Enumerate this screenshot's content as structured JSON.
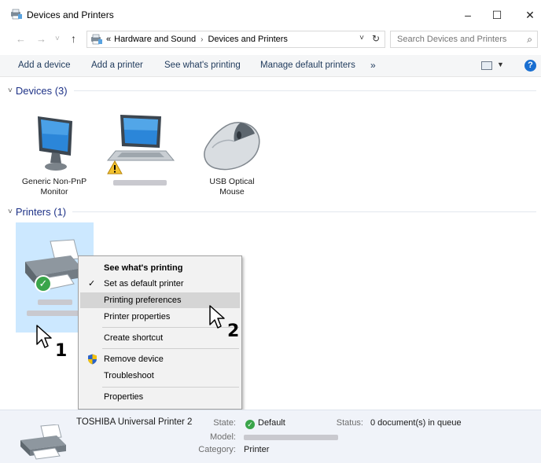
{
  "window": {
    "title": "Devices and Printers",
    "minimize": "–",
    "maximize": "☐",
    "close": "✕"
  },
  "nav": {
    "back": "←",
    "forward": "→",
    "recent": "˅",
    "up": "↑"
  },
  "address": {
    "overflow": "«",
    "crumbs": [
      "Hardware and Sound",
      "Devices and Printers"
    ],
    "separator": "›",
    "dropdown": "˅",
    "refresh": "↻"
  },
  "search": {
    "placeholder": "Search Devices and Printers",
    "icon": "⌕"
  },
  "toolbar": {
    "add_device": "Add a device",
    "add_printer": "Add a printer",
    "see_printing": "See what's printing",
    "manage_default": "Manage default printers",
    "more": "»",
    "view_dropdown": "▼",
    "help": "?"
  },
  "groups": {
    "devices": {
      "chevron": "˅",
      "label": "Devices (3)"
    },
    "printers": {
      "chevron": "˅",
      "label": "Printers (1)"
    }
  },
  "devices": [
    {
      "name_line1": "Generic Non-PnP",
      "name_line2": "Monitor",
      "icon": "monitor-icon"
    },
    {
      "name_line1": "",
      "name_line2": "",
      "icon": "laptop-icon",
      "warning": "!"
    },
    {
      "name_line1": "USB Optical",
      "name_line2": "Mouse",
      "icon": "mouse-icon"
    }
  ],
  "context_menu": {
    "items": [
      {
        "label": "See what's printing"
      },
      {
        "label": "Set as default printer",
        "mark": "✓"
      },
      {
        "label": "Printing preferences"
      },
      {
        "label": "Printer properties"
      },
      {
        "label": "Create shortcut"
      },
      {
        "label": "Remove device"
      },
      {
        "label": "Troubleshoot"
      },
      {
        "label": "Properties"
      }
    ]
  },
  "callouts": {
    "one": "1",
    "two": "2"
  },
  "details": {
    "printer_name": "TOSHIBA Universal Printer 2",
    "state_label": "State:",
    "state_value": "Default",
    "state_mark": "✓",
    "status_label": "Status:",
    "status_value": "0 document(s) in queue",
    "model_label": "Model:",
    "category_label": "Category:",
    "category_value": "Printer"
  },
  "colors": {
    "accent": "#1e3287",
    "selection": "#cce8ff",
    "default_check": "#3aa54a",
    "help": "#1a6fd1"
  }
}
